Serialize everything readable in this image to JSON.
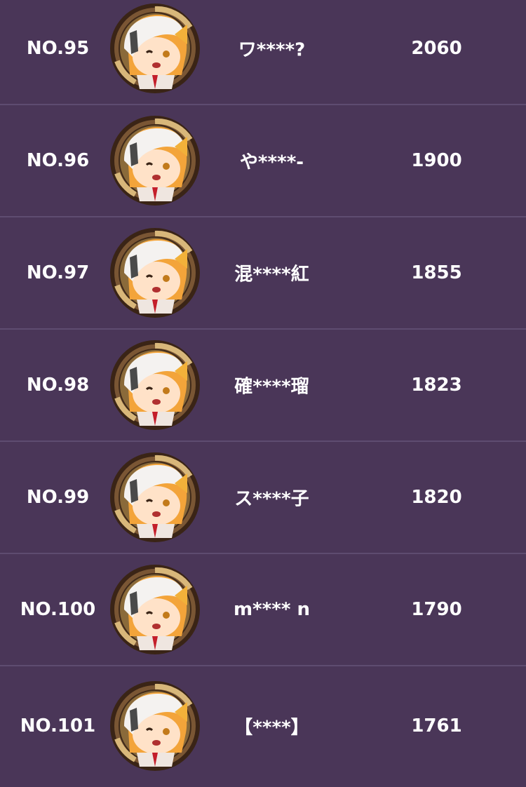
{
  "ranking": [
    {
      "rank": "NO.95",
      "name": "ワ****?",
      "score": "2060"
    },
    {
      "rank": "NO.96",
      "name": "や****-",
      "score": "1900"
    },
    {
      "rank": "NO.97",
      "name": "混****紅",
      "score": "1855"
    },
    {
      "rank": "NO.98",
      "name": "確****瑠",
      "score": "1823"
    },
    {
      "rank": "NO.99",
      "name": "ス****子",
      "score": "1820"
    },
    {
      "rank": "NO.100",
      "name": "m**** n",
      "score": "1790"
    },
    {
      "rank": "NO.101",
      "name": "【****】",
      "score": "1761"
    }
  ],
  "avatar_icon": "chibi-character-portrait-icon",
  "colors": {
    "background": "#4a3658",
    "divider": "#5e4c70",
    "text": "#ffffff",
    "frame": "#6b4a2e",
    "frame_accent": "#c9a66b"
  }
}
